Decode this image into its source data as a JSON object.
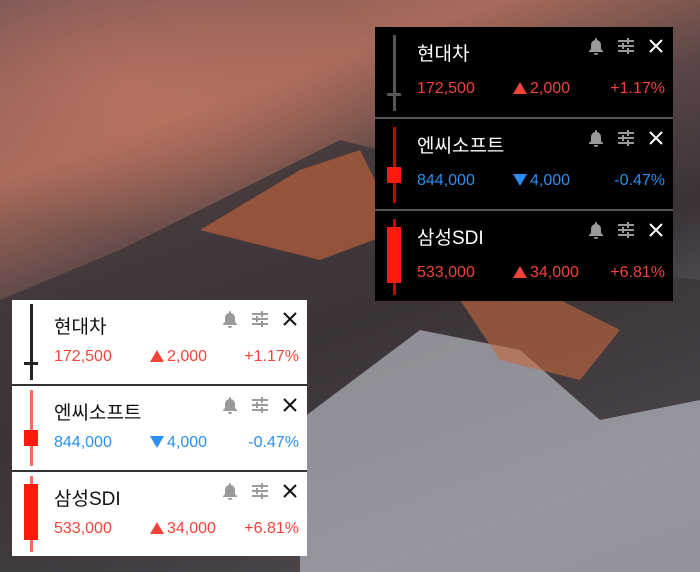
{
  "colors": {
    "up": "#f0443a",
    "down": "#2b8ef0",
    "candle_red": "#ff1a10"
  },
  "icons": {
    "alert": "bell-icon",
    "settings": "sliders-icon",
    "close": "close-icon"
  },
  "icon_glyphs": {
    "bell": "🔔",
    "sliders": "☰",
    "close": "✕"
  },
  "dark_widget": {
    "stocks": [
      {
        "name": "현대차",
        "price": "172,500",
        "change": "2,000",
        "percent": "+1.17%",
        "direction": "up",
        "candle": "doji"
      },
      {
        "name": "엔씨소프트",
        "price": "844,000",
        "change": "4,000",
        "percent": "-0.47%",
        "direction": "down",
        "candle": "small"
      },
      {
        "name": "삼성SDI",
        "price": "533,000",
        "change": "34,000",
        "percent": "+6.81%",
        "direction": "up",
        "candle": "large"
      }
    ]
  },
  "light_widget": {
    "stocks": [
      {
        "name": "현대차",
        "price": "172,500",
        "change": "2,000",
        "percent": "+1.17%",
        "direction": "up",
        "candle": "doji"
      },
      {
        "name": "엔씨소프트",
        "price": "844,000",
        "change": "4,000",
        "percent": "-0.47%",
        "direction": "down",
        "candle": "small"
      },
      {
        "name": "삼성SDI",
        "price": "533,000",
        "change": "34,000",
        "percent": "+6.81%",
        "direction": "up",
        "candle": "large"
      }
    ]
  }
}
